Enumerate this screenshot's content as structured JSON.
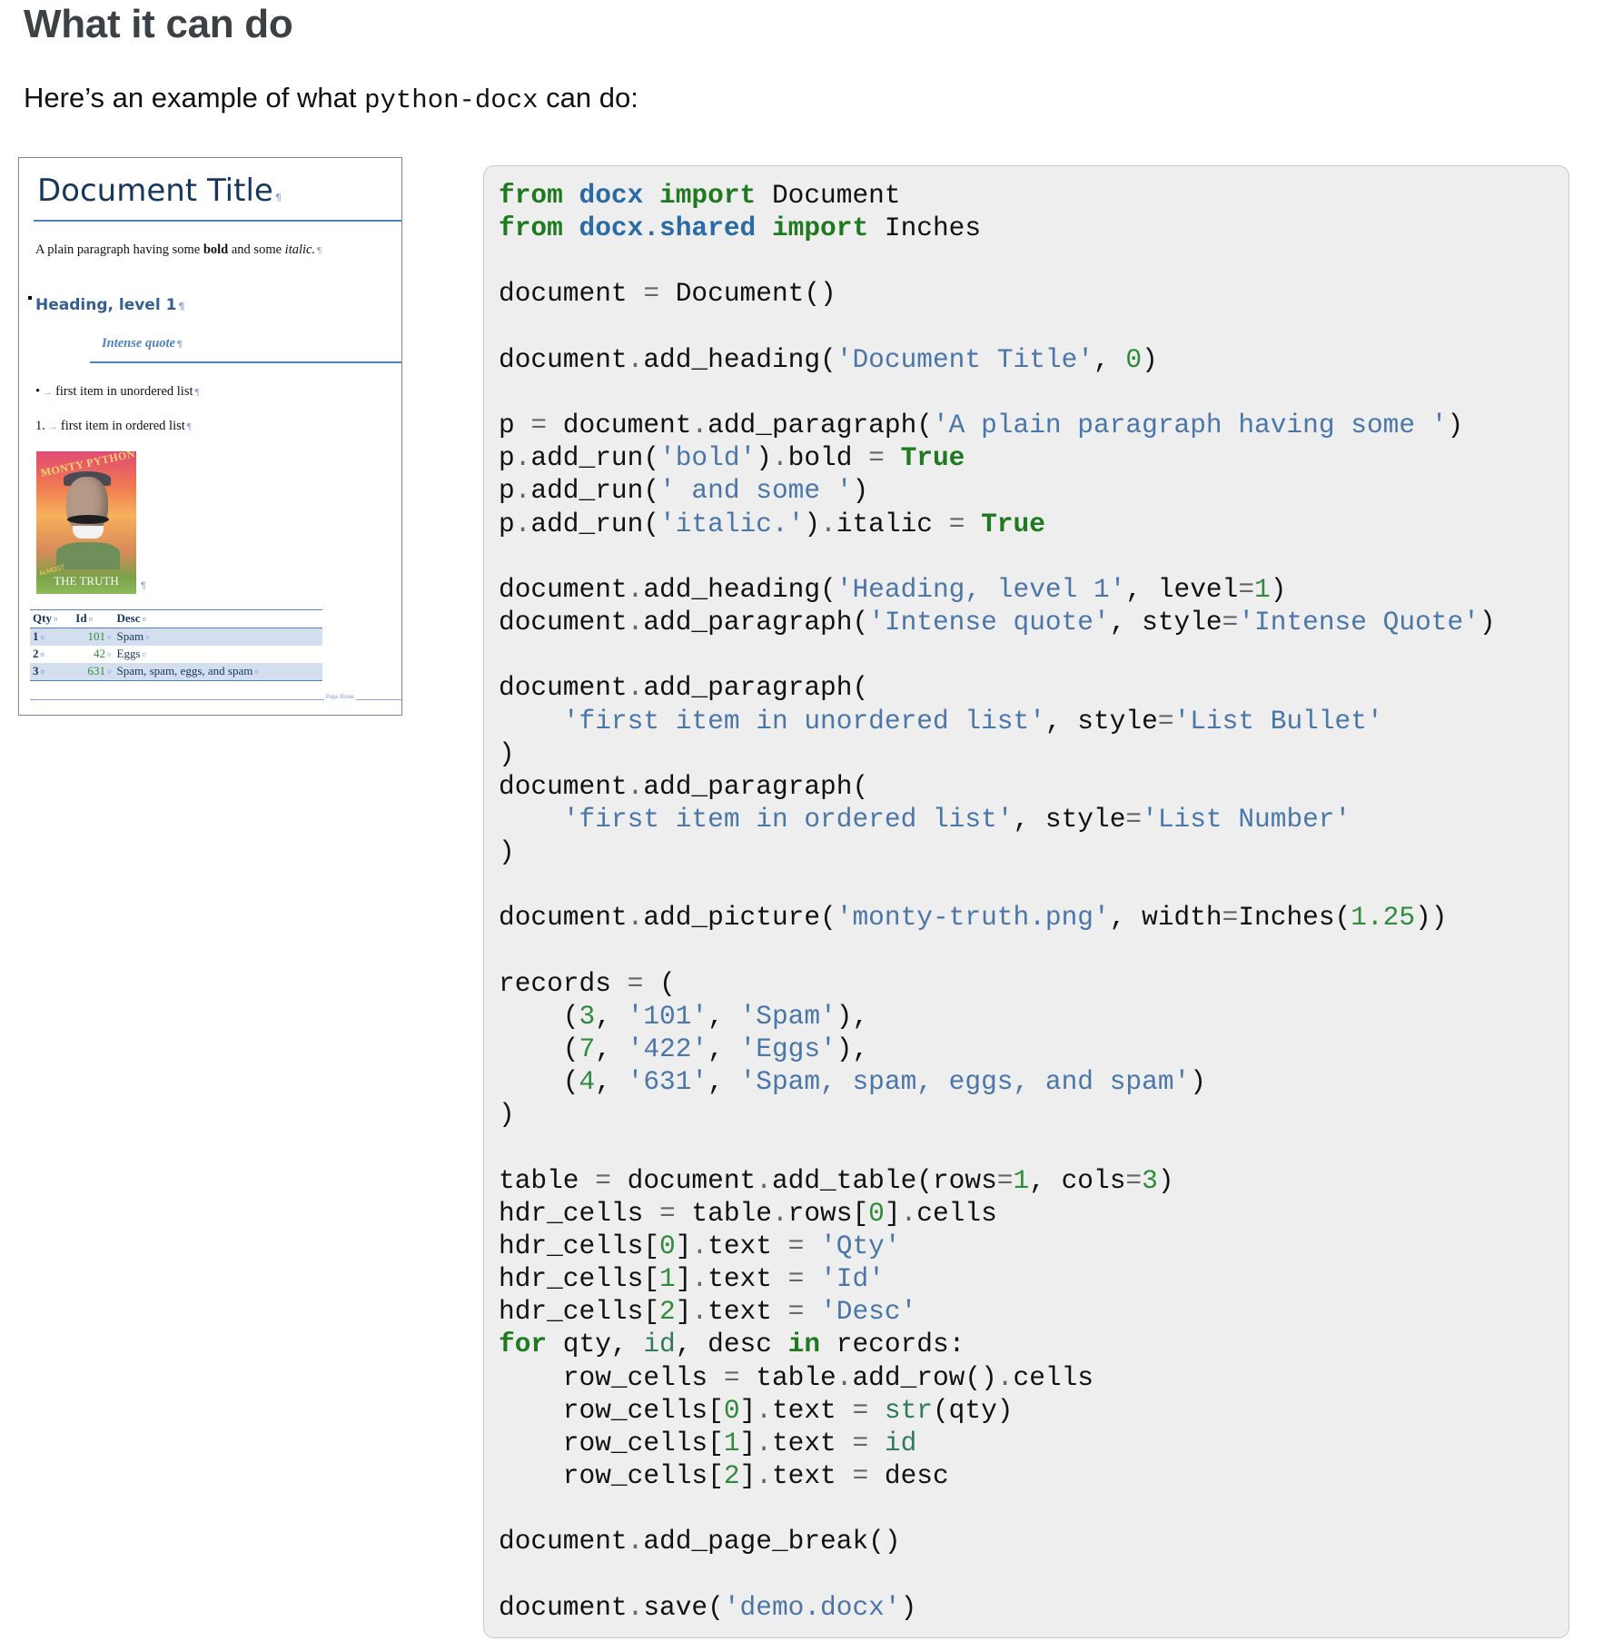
{
  "heading": "What it can do",
  "intro": {
    "prefix": "Here’s an example of what ",
    "code": "python-docx",
    "suffix": " can do:"
  },
  "preview": {
    "title": "Document Title",
    "paragraph": {
      "plain": "A plain paragraph having some ",
      "bold": "bold",
      "middle": " and some ",
      "italic": "italic."
    },
    "heading1": "Heading, level 1",
    "quote": "Intense quote",
    "bullet_marker": "•",
    "bullet_item": "first item in unordered list",
    "number_marker": "1.",
    "number_item": "first item in ordered list",
    "image": {
      "top_text": "MONTY PYTHON",
      "almost": "ALMOST",
      "bottom_text": "THE TRUTH"
    },
    "table": {
      "headers": [
        "Qty",
        "Id",
        "Desc"
      ],
      "rows": [
        [
          "1",
          "101",
          "Spam"
        ],
        [
          "2",
          "42",
          "Eggs"
        ],
        [
          "3",
          "631",
          "Spam, spam, eggs, and spam"
        ]
      ]
    },
    "page_break_label": "Page Break"
  },
  "code": {
    "language": "python",
    "lines": [
      "from docx import Document",
      "from docx.shared import Inches",
      "",
      "document = Document()",
      "",
      "document.add_heading('Document Title', 0)",
      "",
      "p = document.add_paragraph('A plain paragraph having some ')",
      "p.add_run('bold').bold = True",
      "p.add_run(' and some ')",
      "p.add_run('italic.').italic = True",
      "",
      "document.add_heading('Heading, level 1', level=1)",
      "document.add_paragraph('Intense quote', style='Intense Quote')",
      "",
      "document.add_paragraph(",
      "    'first item in unordered list', style='List Bullet'",
      ")",
      "document.add_paragraph(",
      "    'first item in ordered list', style='List Number'",
      ")",
      "",
      "document.add_picture('monty-truth.png', width=Inches(1.25))",
      "",
      "records = (",
      "    (3, '101', 'Spam'),",
      "    (7, '422', 'Eggs'),",
      "    (4, '631', 'Spam, spam, eggs, and spam')",
      ")",
      "",
      "table = document.add_table(rows=1, cols=3)",
      "hdr_cells = table.rows[0].cells",
      "hdr_cells[0].text = 'Qty'",
      "hdr_cells[1].text = 'Id'",
      "hdr_cells[2].text = 'Desc'",
      "for qty, id, desc in records:",
      "    row_cells = table.add_row().cells",
      "    row_cells[0].text = str(qty)",
      "    row_cells[1].text = id",
      "    row_cells[2].text = desc",
      "",
      "document.add_page_break()",
      "",
      "document.save('demo.docx')"
    ]
  },
  "colors": {
    "heading": "#3c4146",
    "code_background": "#eeeeee",
    "keyword": "#1f7a1f",
    "module": "#2a6aa5",
    "string": "#4a76a8",
    "number": "#2f8a3c",
    "doc_title": "#17365d",
    "doc_heading": "#365f91",
    "doc_accent": "#4f81bd"
  }
}
